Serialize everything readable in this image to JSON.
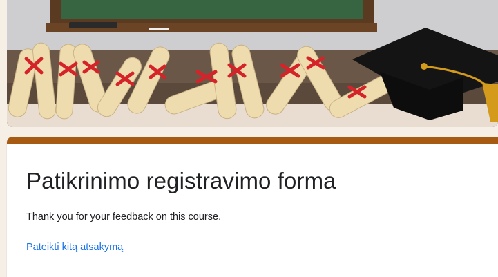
{
  "form": {
    "title": "Patikrinimo registravimo forma",
    "confirmation_message": "Thank you for your feedback on this course.",
    "submit_another_link": "Pateikti kitą atsakymą"
  },
  "colors": {
    "accent": "#a65a12",
    "link": "#1a73e8",
    "background": "#f6efe6"
  },
  "header_image": {
    "icon": "graduation-banner-illustration"
  }
}
